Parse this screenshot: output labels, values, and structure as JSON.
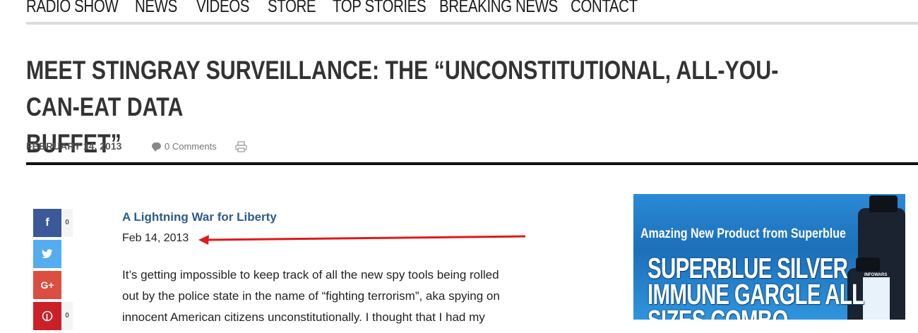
{
  "nav": {
    "items": [
      "RADIO SHOW",
      "NEWS",
      "VIDEOS",
      "STORE",
      "TOP STORIES",
      "BREAKING NEWS",
      "CONTACT"
    ]
  },
  "post": {
    "title_line1": "MEET STINGRAY SURVEILLANCE: THE “UNCONSTITUTIONAL, ALL-YOU-CAN-EAT DATA",
    "title_line2": "BUFFET”",
    "date": "FEBRUARY 14, 2013",
    "comments": "0 Comments"
  },
  "share": {
    "facebook_count": "0",
    "pinterest_count": "0",
    "facebook_icon": "f",
    "gplus_icon": "G+",
    "colors": {
      "facebook": "#3b5998",
      "twitter": "#55acee",
      "gplus": "#dc4e41",
      "pinterest": "#cb2027"
    }
  },
  "article": {
    "source_link": "A Lightning War for Liberty",
    "source_date": "Feb 14, 2013",
    "body_lines": [
      "It’s getting impossible to keep track of all the new spy tools being rolled",
      "out by the police state in the name of “fighting terrorism”, aka spying on",
      "innocent American citizens unconstitutionally.  I thought that I had my"
    ]
  },
  "ad": {
    "tagline": "Amazing New Product from Superblue",
    "line1": "SUPERBLUE SILVER",
    "line2": "IMMUNE GARGLE ALL",
    "line3": "SIZES COMBO",
    "bottle_text": "INFOWARS"
  },
  "annotation": {
    "arrow_color": "#e0191b"
  }
}
